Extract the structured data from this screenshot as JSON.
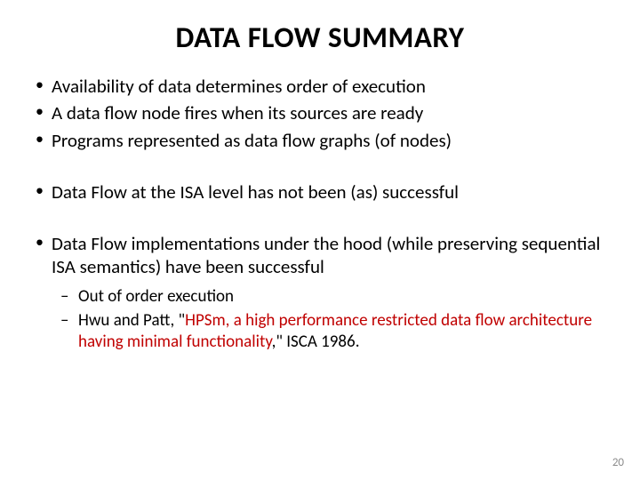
{
  "title": "DATA FLOW SUMMARY",
  "bullets": {
    "a": "Availability of data determines order of execution",
    "b": "A data flow node fires when its sources are ready",
    "c": "Programs represented as data flow graphs (of nodes)",
    "d": "Data Flow at the ISA level has not been (as) successful",
    "e": "Data Flow implementations under the hood (while preserving sequential ISA semantics) have been successful"
  },
  "sub": {
    "a": "Out of order execution",
    "b_prefix": "Hwu and Patt, \"",
    "b_title": "HPSm, a high performance restricted data flow architecture having minimal functionality",
    "b_suffix": ",\" ISCA 1986."
  },
  "page_number": "20"
}
